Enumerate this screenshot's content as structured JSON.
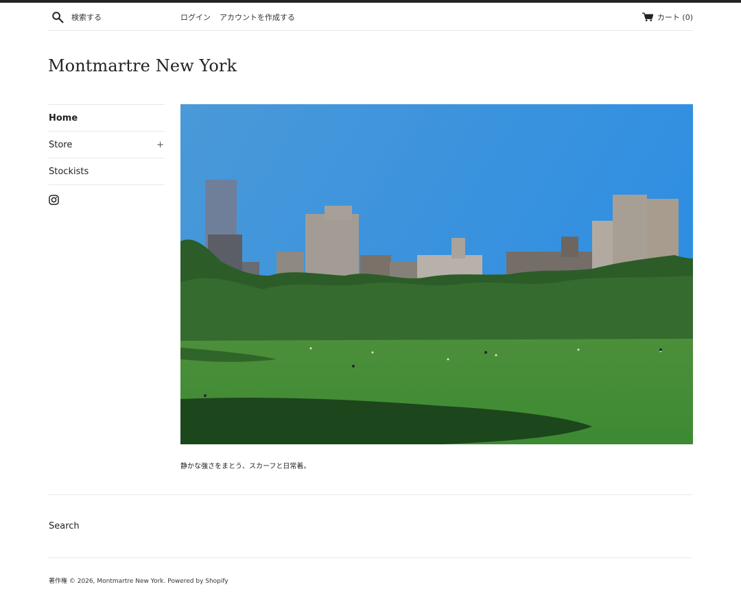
{
  "header": {
    "search_placeholder": "検索する",
    "login_label": "ログイン",
    "create_account_label": "アカウントを作成する",
    "cart_label": "カート (0)",
    "search_icon": "search-icon",
    "cart_icon": "cart-icon"
  },
  "site": {
    "title": "Montmartre New York"
  },
  "sidebar": {
    "items": [
      {
        "label": "Home",
        "active": true
      },
      {
        "label": "Store",
        "expand_symbol": "+"
      },
      {
        "label": "Stockists"
      }
    ],
    "social_icon": "instagram-icon"
  },
  "main": {
    "hero_alt": "",
    "tagline": "静かな強さをまとう、スカーフと日常着。"
  },
  "footer": {
    "search_label": "Search",
    "copyright_prefix": "著作権 © 2026,",
    "copyright_store": "Montmartre New York",
    "powered_by": ". Powered by Shopify"
  },
  "colors": {
    "top_rule": "#232323",
    "divider": "#e8e8e8",
    "text": "#222222",
    "sky_top": "#3b8fd6",
    "grass": "#3f8a35"
  }
}
